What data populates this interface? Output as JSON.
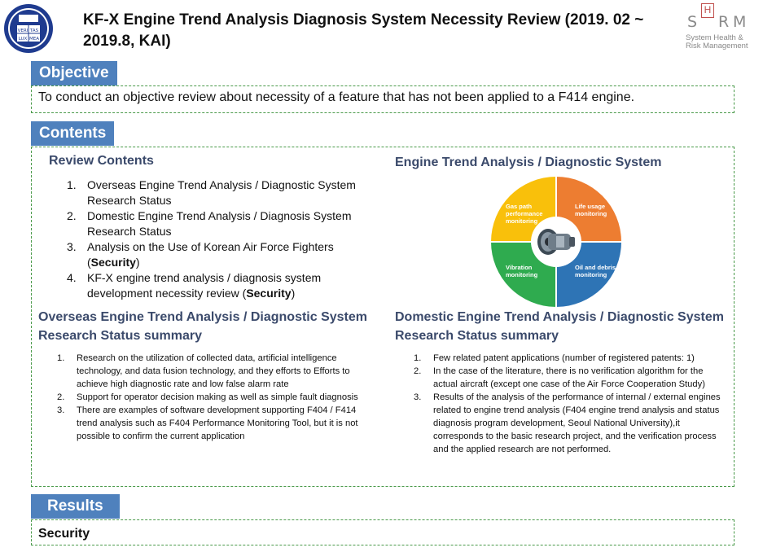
{
  "header": {
    "title": "KF-X Engine Trend Analysis Diagnosis System Necessity Review (2019. 02 ~ 2019.8, KAI)",
    "logo_left_text": [
      "VERI",
      "TAS",
      "LUX",
      "MEA"
    ],
    "logo_right": {
      "letters": [
        "S",
        "H",
        "R",
        "M"
      ],
      "caption_line1": "System Health &",
      "caption_line2": "Risk Management"
    }
  },
  "objective": {
    "label": "Objective",
    "text": "To conduct an objective review about necessity of a feature that has not been applied to a F414 engine."
  },
  "contents": {
    "label": "Contents",
    "review": {
      "heading": "Review Contents",
      "items": [
        {
          "num": "1.",
          "text": "Overseas Engine Trend Analysis / Diagnostic System Research Status",
          "bold": ""
        },
        {
          "num": "2.",
          "text": "Domestic Engine Trend Analysis / Diagnosis System Research Status",
          "bold": ""
        },
        {
          "num": "3.",
          "text": "Analysis on the Use of Korean Air Force Fighters (",
          "bold": "Security",
          "after": ")"
        },
        {
          "num": "4.",
          "text": "KF-X engine trend analysis / diagnosis system development necessity review (",
          "bold": "Security",
          "after": ")"
        }
      ]
    },
    "diagram": {
      "heading": "Engine Trend Analysis / Diagnostic System",
      "quadrants": [
        {
          "label": "Gas path performance monitoring",
          "color": "#f9c00b"
        },
        {
          "label": "Life usage monitoring",
          "color": "#ed7d31"
        },
        {
          "label": "Vibration monitoring",
          "color": "#2fab4f"
        },
        {
          "label": "Oil and debris monitoring",
          "color": "#2e74b5"
        }
      ]
    },
    "overseas": {
      "heading_line1": "Overseas Engine Trend Analysis / Diagnostic System",
      "heading_line2": "Research Status summary",
      "items": [
        {
          "num": "1.",
          "text": "Research on the utilization of collected data, artificial intelligence technology, and data fusion technology, and they efforts to Efforts to achieve high diagnostic rate and low false alarm rate"
        },
        {
          "num": "2.",
          "text": "Support for operator decision making as well as simple fault diagnosis"
        },
        {
          "num": "3.",
          "text": "There are examples of software development supporting F404 / F414 trend analysis such as F404 Performance Monitoring Tool, but it is not possible to confirm the current application"
        }
      ]
    },
    "domestic": {
      "heading_line1": "Domestic Engine Trend Analysis / Diagnostic System",
      "heading_line2": "Research Status summary",
      "items": [
        {
          "num": "1.",
          "text": "Few related patent applications (number of registered patents: 1)"
        },
        {
          "num": "2.",
          "text": "In the case of the literature, there is no verification algorithm for the actual aircraft (except one case of the Air Force Cooperation Study)"
        },
        {
          "num": "3.",
          "text": "Results of the analysis of the performance of internal / external engines related to engine trend analysis (F404 engine trend analysis and status diagnosis program development, Seoul National University),it corresponds to the basic research project, and the verification process and the applied research are not performed."
        }
      ]
    }
  },
  "results": {
    "label": "Results",
    "text": "Security"
  },
  "colors": {
    "tab_blue": "#4f81bd",
    "dashed_green": "#4a9a4a",
    "heading_navy": "#3b4a6b",
    "srm_red": "#c0504d"
  }
}
